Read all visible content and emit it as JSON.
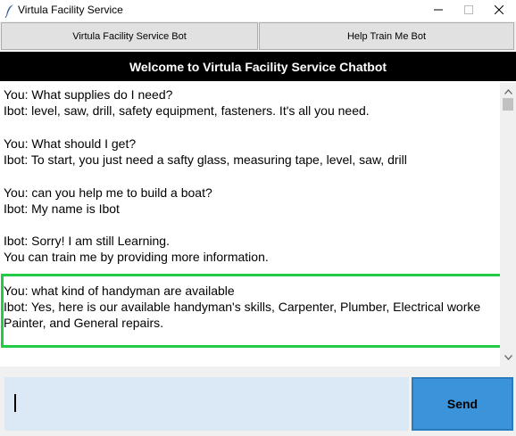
{
  "window": {
    "title": "Virtula Facility Service",
    "icon": "feather-icon",
    "controls": [
      "minimize-icon",
      "maximize-icon",
      "close-icon"
    ]
  },
  "tabs": [
    {
      "label": "Virtula Facility Service Bot"
    },
    {
      "label": "Help Train Me Bot"
    }
  ],
  "header": {
    "title": "Welcome to Virtula Facility Service Chatbot"
  },
  "chat": {
    "blocks": [
      {
        "lines": [
          "You: What supplies do I need?",
          "Ibot: level, saw, drill, safety equipment, fasteners. It's all you need."
        ]
      },
      {
        "lines": [
          "You: What should I get?",
          "Ibot: To start, you just need a safty glass, measuring tape, level, saw, drill"
        ]
      },
      {
        "lines": [
          "You: can you help me to build a boat?",
          "Ibot: My name is Ibot"
        ]
      },
      {
        "lines": [
          "Ibot: Sorry! I am still Learning.",
          "You can train me by providing more information."
        ]
      },
      {
        "lines": [
          "You: what kind of handyman are available",
          "Ibot: Yes, here is our available handyman's skills, Carpenter, Plumber, Electrical worke",
          "Painter, and General repairs."
        ]
      }
    ],
    "highlight_color": "#22cc44"
  },
  "input": {
    "value": "",
    "placeholder": ""
  },
  "send": {
    "label": "Send"
  },
  "colors": {
    "header_bg": "#000000",
    "input_bg": "#dbe9f6",
    "send_bg": "#3b94d9"
  }
}
